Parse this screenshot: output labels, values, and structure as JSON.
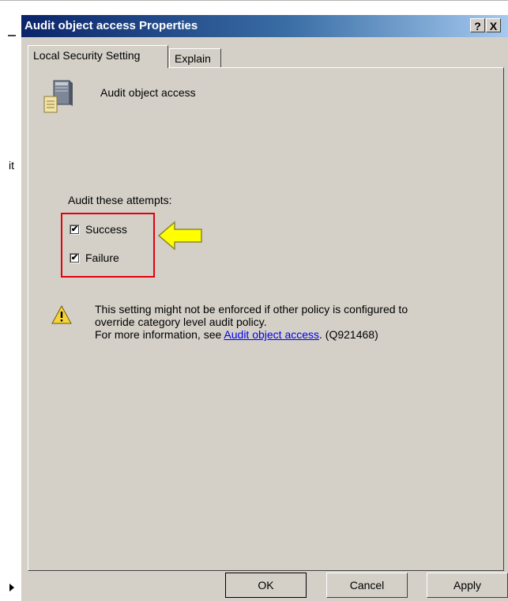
{
  "background": {
    "fragment_text": "it"
  },
  "dialog": {
    "title": "Audit object access Properties",
    "help_label": "?",
    "close_label": "X"
  },
  "tabs": [
    {
      "label": "Local Security Setting",
      "active": true
    },
    {
      "label": "Explain",
      "active": false
    }
  ],
  "policy": {
    "name": "Audit object access",
    "icon": "server-policy-icon"
  },
  "audit": {
    "label": "Audit these attempts:",
    "options": [
      {
        "label": "Success",
        "checked": true
      },
      {
        "label": "Failure",
        "checked": true
      }
    ]
  },
  "warning": {
    "icon": "warning-icon",
    "line1": "This setting might not be enforced if other policy is configured to",
    "line2": "override category level audit policy.",
    "line3_prefix": "For more information, see ",
    "link_text": "Audit object access",
    "line3_suffix": ". (Q921468)"
  },
  "buttons": {
    "ok": "OK",
    "cancel": "Cancel",
    "apply": "Apply"
  },
  "colors": {
    "highlight": "#e3000f",
    "callout_arrow": "#ffff00",
    "dialog_face": "#d4d0c8",
    "titlebar": "#0a246a"
  }
}
